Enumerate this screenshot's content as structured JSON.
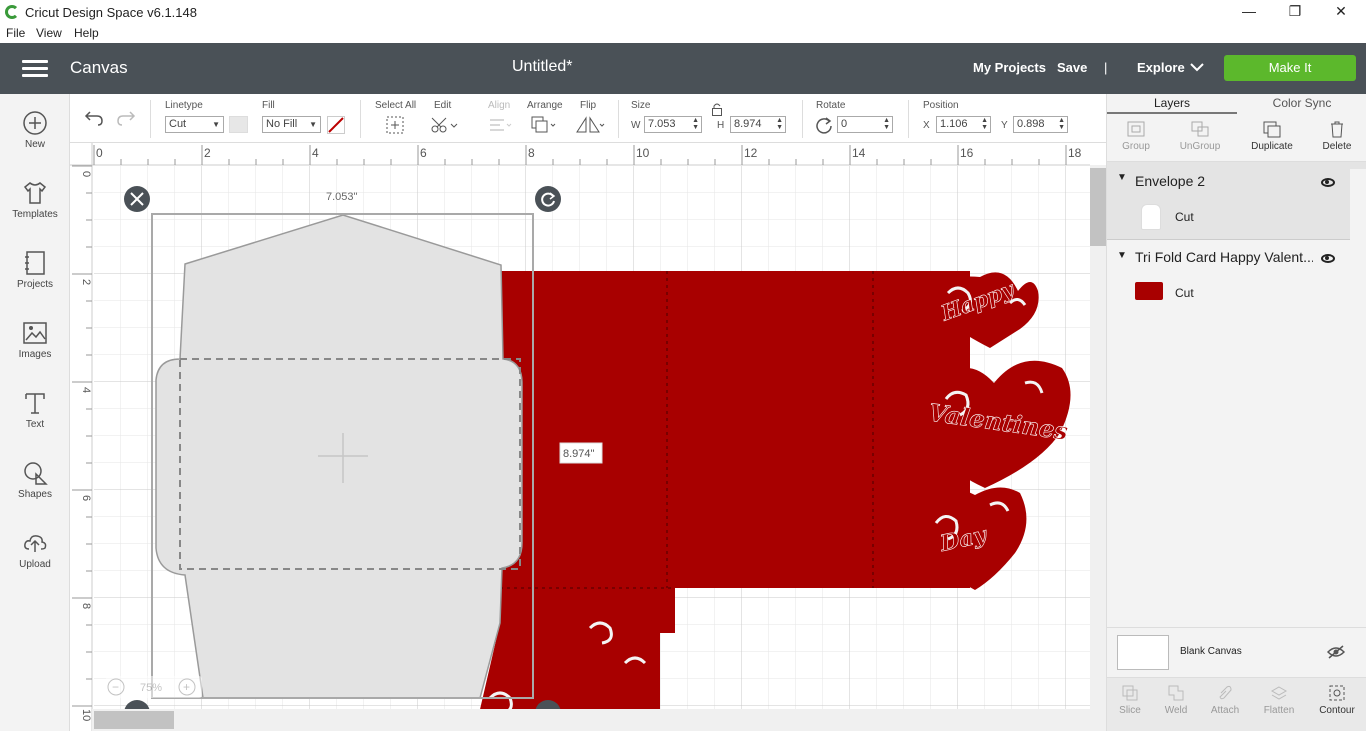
{
  "app": {
    "title": "Cricut Design Space  v6.1.148"
  },
  "window_controls": {
    "minimize": "—",
    "restore": "❐",
    "close": "✕"
  },
  "menu": [
    "File",
    "View",
    "Help"
  ],
  "header": {
    "section": "Canvas",
    "document": "Untitled*",
    "my_projects": "My Projects",
    "save": "Save",
    "divider": "|",
    "explore": "Explore",
    "make_it": "Make It"
  },
  "sidebar": [
    {
      "label": "New",
      "icon": "plus-circle-icon"
    },
    {
      "label": "Templates",
      "icon": "tshirt-icon"
    },
    {
      "label": "Projects",
      "icon": "notebook-icon"
    },
    {
      "label": "Images",
      "icon": "image-icon"
    },
    {
      "label": "Text",
      "icon": "text-t-icon"
    },
    {
      "label": "Shapes",
      "icon": "shapes-icon"
    },
    {
      "label": "Upload",
      "icon": "cloud-upload-icon"
    }
  ],
  "toolbar": {
    "linetype_label": "Linetype",
    "linetype_value": "Cut",
    "fill_label": "Fill",
    "fill_value": "No Fill",
    "select_all": "Select All",
    "edit": "Edit",
    "align": "Align",
    "arrange": "Arrange",
    "flip": "Flip",
    "size": "Size",
    "w_label": "W",
    "w_value": "7.053",
    "h_label": "H",
    "h_value": "8.974",
    "rotate": "Rotate",
    "rotate_value": "0",
    "position": "Position",
    "x_label": "X",
    "x_value": "1.106",
    "y_label": "Y",
    "y_value": "0.898"
  },
  "ruler": {
    "top": [
      "0",
      "2",
      "4",
      "6",
      "8",
      "10",
      "12",
      "14",
      "16",
      "18"
    ],
    "left": [
      "0",
      "2",
      "4",
      "6",
      "8",
      "10"
    ]
  },
  "canvas": {
    "width_tag": "7.053\"",
    "height_tag": "8.974\"",
    "zoom": "75%",
    "zoom_out": "−",
    "zoom_in": "+"
  },
  "card_text": [
    "Happy",
    "Valentines",
    "Day"
  ],
  "colors": {
    "card": "#a80000",
    "envelope": "#e3e3e3",
    "header": "#4a5157",
    "make_it": "#5cb82c"
  },
  "right_panel": {
    "tabs": [
      "Layers",
      "Color Sync"
    ],
    "actions": [
      {
        "label": "Group",
        "enabled": false
      },
      {
        "label": "UnGroup",
        "enabled": false
      },
      {
        "label": "Duplicate",
        "enabled": true
      },
      {
        "label": "Delete",
        "enabled": true
      }
    ],
    "layers": [
      {
        "name": "Envelope 2",
        "op": "Cut"
      },
      {
        "name": "Tri Fold Card Happy Valent...",
        "op": "Cut"
      }
    ],
    "blank_canvas": "Blank Canvas",
    "bottom_actions": [
      {
        "label": "Slice",
        "enabled": false
      },
      {
        "label": "Weld",
        "enabled": false
      },
      {
        "label": "Attach",
        "enabled": false
      },
      {
        "label": "Flatten",
        "enabled": false
      },
      {
        "label": "Contour",
        "enabled": true
      }
    ]
  }
}
